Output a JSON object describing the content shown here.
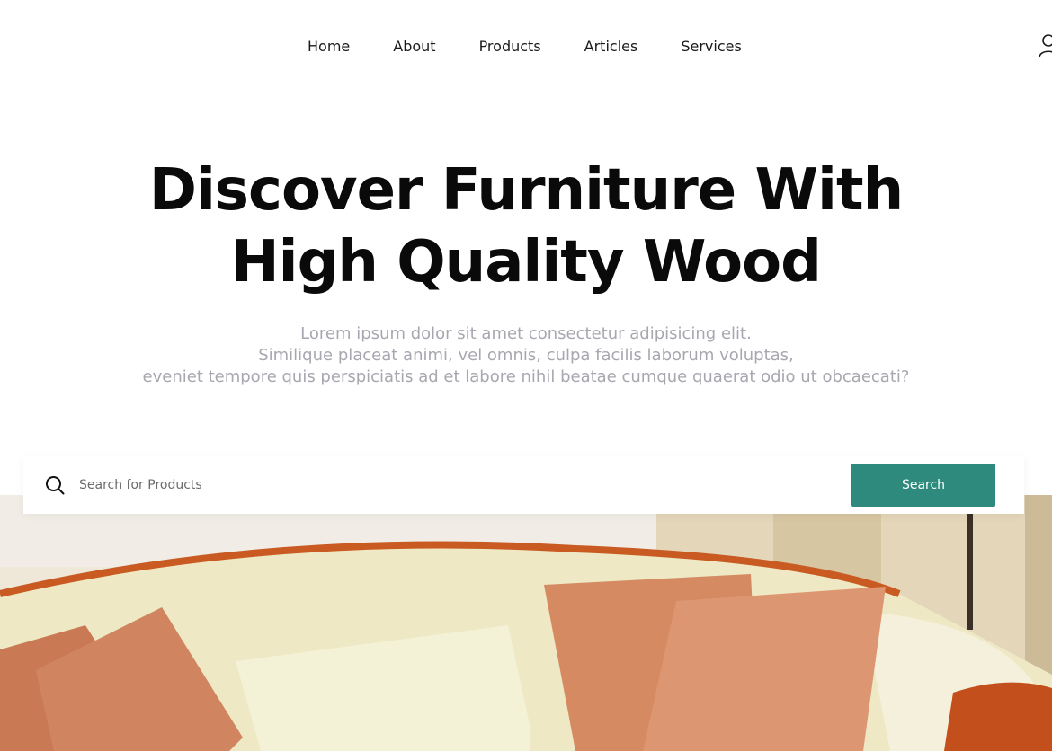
{
  "nav": {
    "items": [
      {
        "label": "Home"
      },
      {
        "label": "About"
      },
      {
        "label": "Products"
      },
      {
        "label": "Articles"
      },
      {
        "label": "Services"
      }
    ],
    "user_icon": "user-icon"
  },
  "hero": {
    "title_line1": "Discover Furniture With",
    "title_line2": "High Quality Wood",
    "subtitle_line1": "Lorem ipsum dolor sit amet consectetur adipisicing elit.",
    "subtitle_line2": "Similique placeat animi, vel omnis, culpa facilis laborum voluptas,",
    "subtitle_line3": "eveniet tempore quis perspiciatis ad et labore nihil beatae cumque quaerat odio ut obcaecati?"
  },
  "search": {
    "placeholder": "Search for Products",
    "value": "",
    "button_label": "Search",
    "icon": "search-icon"
  },
  "colors": {
    "accent": "#2e8a7c",
    "subtitle": "#a7a7b0",
    "title": "#0a0a0a"
  }
}
